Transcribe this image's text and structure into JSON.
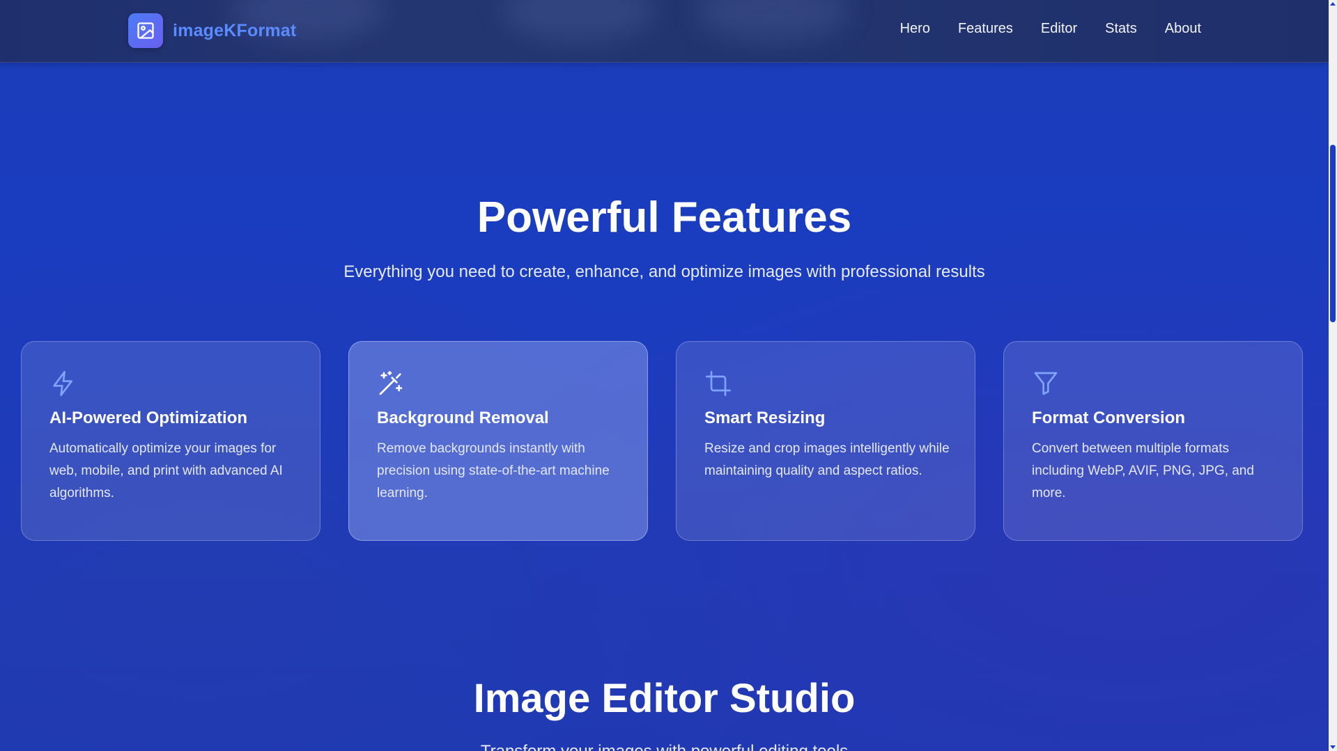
{
  "header": {
    "brand": "imageKFormat",
    "brand_color": "#5b8cff",
    "logo_icon": "image-icon",
    "nav": [
      {
        "label": "Hero"
      },
      {
        "label": "Features"
      },
      {
        "label": "Editor"
      },
      {
        "label": "Stats"
      },
      {
        "label": "About"
      }
    ]
  },
  "features": {
    "title": "Powerful Features",
    "subtitle": "Everything you need to create, enhance, and optimize images with professional results",
    "cards": [
      {
        "icon": "lightning-icon",
        "title": "AI-Powered Optimization",
        "description": "Automatically optimize your images for web, mobile, and print with advanced AI algorithms."
      },
      {
        "icon": "magic-wand-icon",
        "title": "Background Removal",
        "description": "Remove backgrounds instantly with precision using state-of-the-art machine learning."
      },
      {
        "icon": "crop-icon",
        "title": "Smart Resizing",
        "description": "Resize and crop images intelligently while maintaining quality and aspect ratios."
      },
      {
        "icon": "funnel-icon",
        "title": "Format Conversion",
        "description": "Convert between multiple formats including WebP, AVIF, PNG, JPG, and more."
      }
    ]
  },
  "editor": {
    "title": "Image Editor Studio",
    "subtitle": "Transform your images with powerful editing tools"
  },
  "colors": {
    "accent": "#5b8cff",
    "icon": "#7fa4ff",
    "background": "#1b3dbb"
  }
}
